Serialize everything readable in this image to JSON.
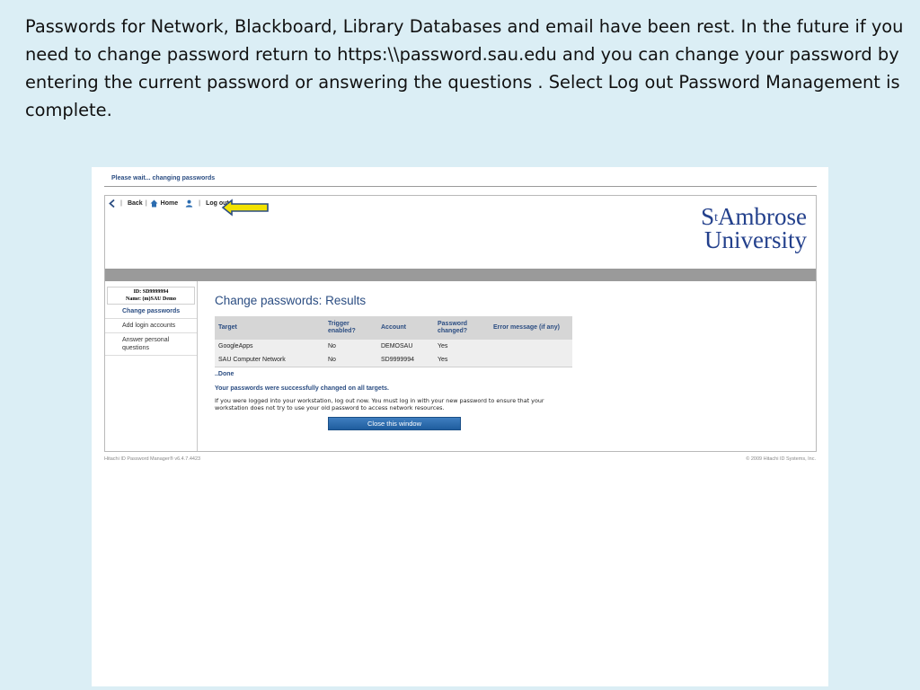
{
  "slide": {
    "text": "Passwords for Network, Blackboard, Library Databases and email have been rest. In the future if you need to change password return to https:\\\\password.sau.edu and you can change your password by entering the current password or answering the questions . Select Log out Password Management is complete."
  },
  "colors": {
    "arrow_fill": "#f2e200",
    "arrow_stroke": "#2b4d82",
    "brand": "#23408c"
  },
  "screenshot": {
    "status_bar": "Please wait... changing passwords",
    "nav": {
      "back": "Back",
      "home": "Home",
      "logout": "Log out"
    },
    "logo": {
      "line1_a": "S",
      "line1_sup": "t",
      "line1_b": "Ambrose",
      "line2": "University"
    },
    "user": {
      "id": "ID: SD9999994",
      "name": "Name: (m)SAU Demo"
    },
    "sidebar": {
      "items": [
        {
          "label": "Change passwords"
        },
        {
          "label": "Add login accounts"
        },
        {
          "label": "Answer personal questions"
        }
      ]
    },
    "page_title": "Change passwords: Results",
    "table": {
      "headers": [
        "Target",
        "Trigger enabled?",
        "Account",
        "Password changed?",
        "Error message (if any)"
      ],
      "rows": [
        [
          "GoogleApps",
          "No",
          "DEMOSAU",
          "Yes",
          ""
        ],
        [
          "SAU Computer Network",
          "No",
          "SD9999994",
          "Yes",
          ""
        ]
      ]
    },
    "done": "..Done",
    "success": "Your passwords were successfully changed on all targets.",
    "note": "If you were logged into your workstation, log out now. You must log in with your new password to ensure that your workstation does not try to use your old password to access network resources.",
    "close_button": "Close this window",
    "footer_left": "Hitachi ID Password Manager® v6.4.7.4423",
    "footer_right": "© 2009 Hitachi ID Systems, Inc."
  }
}
